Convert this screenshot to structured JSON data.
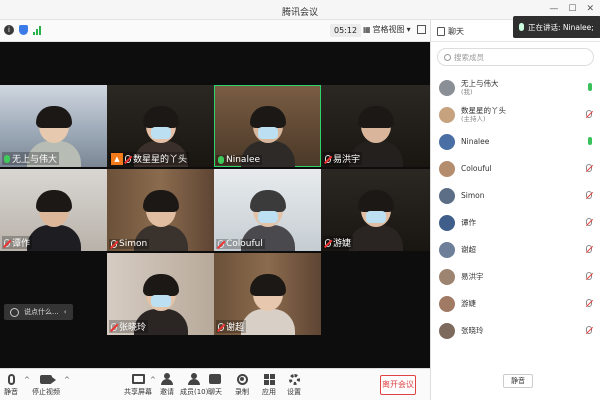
{
  "window": {
    "title": "腾讯会议"
  },
  "infobar": {
    "timer": "05:12",
    "view_mode": "宫格视图",
    "view_caret": "▾"
  },
  "tiles": [
    {
      "name": "无上与伟大",
      "mic": "on"
    },
    {
      "name": "数星星的丫头",
      "mic": "muted",
      "host": true
    },
    {
      "name": "Ninalee",
      "mic": "on",
      "speaking": true
    },
    {
      "name": "易洪宇",
      "mic": "muted"
    },
    {
      "name": "谭作",
      "mic": "muted"
    },
    {
      "name": "Simon",
      "mic": "muted"
    },
    {
      "name": "Colouful",
      "mic": "muted"
    },
    {
      "name": "游婕",
      "mic": "muted"
    },
    {
      "name": "张晓玲",
      "mic": "muted"
    },
    {
      "name": "谢超",
      "mic": "muted"
    }
  ],
  "chat_hint": {
    "text": "说点什么...",
    "arrow": "‹"
  },
  "toolbar": {
    "mute": "静音",
    "stop_video": "停止视频",
    "share": "共享屏幕",
    "invite": "邀请",
    "members": "成员(10)",
    "chat": "聊天",
    "record": "录制",
    "apps": "应用",
    "settings": "设置",
    "leave": "离开会议",
    "caret": "^"
  },
  "panel": {
    "tab_chat": "聊天",
    "speaking_banner": "正在讲话: Ninalee;",
    "search_placeholder": "搜索成员",
    "mute_all": "静音",
    "members": [
      {
        "name": "无上与伟大",
        "role": "(我)",
        "mic": "on",
        "avatar_color": "#8a8f96"
      },
      {
        "name": "数星星的丫头",
        "role": "(主持人)",
        "mic": "off",
        "avatar_color": "#c7a27f"
      },
      {
        "name": "Ninalee",
        "role": "",
        "mic": "on",
        "avatar_color": "#4a6fa5"
      },
      {
        "name": "Colouful",
        "role": "",
        "mic": "off",
        "avatar_color": "#b48c6e"
      },
      {
        "name": "Simon",
        "role": "",
        "mic": "off",
        "avatar_color": "#5c6e86"
      },
      {
        "name": "谭作",
        "role": "",
        "mic": "off",
        "avatar_color": "#3f5f8a"
      },
      {
        "name": "谢超",
        "role": "",
        "mic": "off",
        "avatar_color": "#6d7f99"
      },
      {
        "name": "易洪宇",
        "role": "",
        "mic": "off",
        "avatar_color": "#9d8470"
      },
      {
        "name": "游婕",
        "role": "",
        "mic": "off",
        "avatar_color": "#a07a64"
      },
      {
        "name": "张晓玲",
        "role": "",
        "mic": "off",
        "avatar_color": "#7d6a5d"
      }
    ]
  }
}
